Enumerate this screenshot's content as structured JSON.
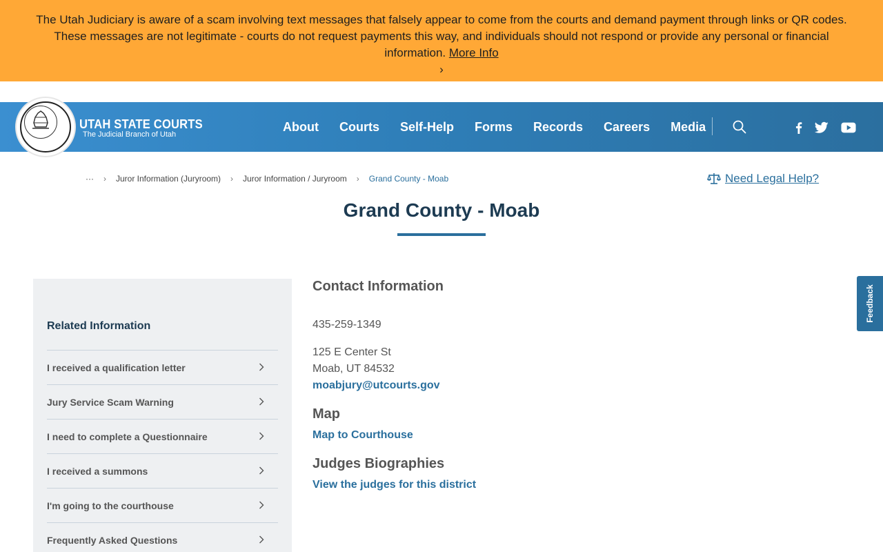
{
  "alert": {
    "message": "The Utah Judiciary is aware of a scam involving text messages that falsely appear to come from the courts and demand payment through links or QR codes. These messages are not legitimate - courts do not request payments this way, and individuals should not respond or provide any personal or financial information. ",
    "link_label": "More Info",
    "chevron": "›"
  },
  "header": {
    "brand_title": "UTAH STATE COURTS",
    "brand_subtitle": "The Judicial Branch of Utah",
    "nav": [
      "About",
      "Courts",
      "Self-Help",
      "Forms",
      "Records",
      "Careers",
      "Media"
    ]
  },
  "breadcrumb": {
    "ellipsis": "···",
    "items": [
      "Juror Information (Juryroom)",
      "Juror Information / Juryroom"
    ],
    "current": "Grand County - Moab",
    "separator": "›"
  },
  "legal_help": {
    "label": "Need Legal Help?"
  },
  "page": {
    "title": "Grand County - Moab"
  },
  "sidebar": {
    "heading": "Related Information",
    "items": [
      "I received a qualification letter",
      "Jury Service Scam Warning",
      "I need to complete a Questionnaire",
      "I received a summons",
      "I'm going to the courthouse",
      "Frequently Asked Questions"
    ]
  },
  "contact": {
    "heading": "Contact Information",
    "phone": "435-259-1349",
    "address_line1": "125 E Center St",
    "address_line2": "Moab, UT 84532",
    "email": "moabjury@utcourts.gov"
  },
  "map": {
    "heading": "Map",
    "link_label": "Map to Courthouse"
  },
  "judges": {
    "heading": "Judges Biographies",
    "link_label": "View the judges for this district"
  },
  "feedback": {
    "label": "Feedback"
  },
  "colors": {
    "alert_bg": "#ffa836",
    "header_blue": "#2f7fb9",
    "link_blue": "#2a6f9d",
    "title_navy": "#1d3b52",
    "sidebar_bg": "#eef0f2"
  }
}
